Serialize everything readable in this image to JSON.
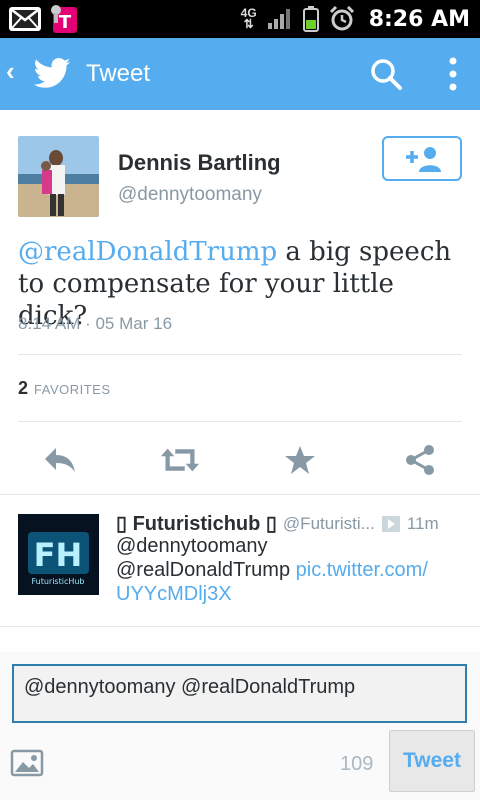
{
  "status_bar": {
    "time": "8:26 AM",
    "network": "4G"
  },
  "app_bar": {
    "back_glyph": "‹",
    "title": "Tweet"
  },
  "tweet": {
    "author_name": "Dennis Bartling",
    "author_handle": "@dennytoomany",
    "mention": "@realDonaldTrump",
    "body": " a big speech to compensate for your little dick?",
    "timestamp": "8:14 AM · 05 Mar 16",
    "favorites_count": "2",
    "favorites_label": "FAVORITES"
  },
  "reply": {
    "name_prefix_glyph": "▯",
    "name": "Futuristichub",
    "name_suffix_glyph": "▯",
    "handle": "@Futuristi...",
    "time": "11m",
    "avatar_text": "FH",
    "avatar_subtext": "FuturisticHub",
    "line1": "@dennytoomany",
    "line2_plain": "@realDonaldTrump ",
    "line2_link": "pic.twitter.com/",
    "line3_link": "UYYcMDlj3X"
  },
  "compose": {
    "value": "@dennytoomany @realDonaldTrump",
    "char_count": "109",
    "tweet_label": "Tweet"
  },
  "icons": {
    "appbar": [
      "back-icon",
      "twitter-bird-icon",
      "search-icon",
      "overflow-menu-icon"
    ],
    "actions": [
      "reply-icon",
      "retweet-icon",
      "favorite-star-icon",
      "share-icon"
    ],
    "compose": [
      "photo-icon"
    ]
  },
  "colors": {
    "accent": "#55acee",
    "status_bar": "#000000",
    "text": "#292f33",
    "muted": "#8899a6"
  }
}
